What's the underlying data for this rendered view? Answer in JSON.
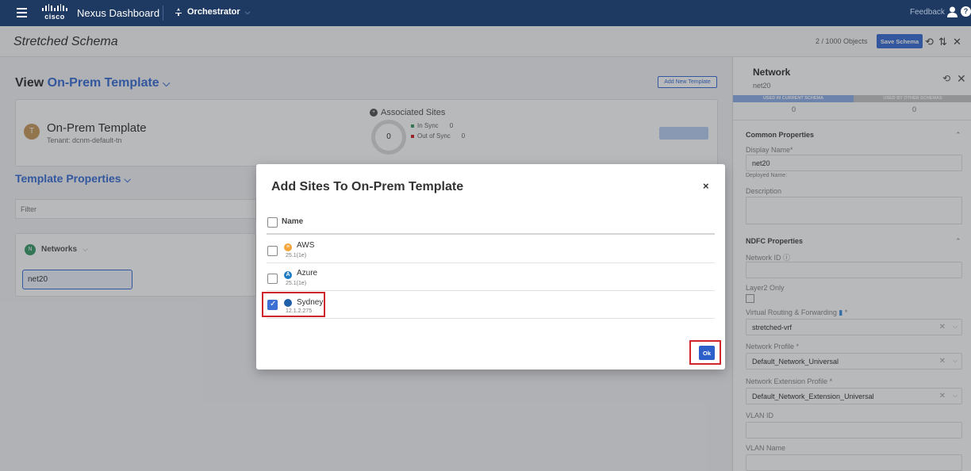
{
  "topnav": {
    "app_title": "Nexus Dashboard",
    "logo_text": "cisco",
    "section": "Orchestrator",
    "feedback": "Feedback",
    "help": "?"
  },
  "schema": {
    "title": "Stretched Schema",
    "object_count": "2 / 1000 Objects",
    "save_label": "Save Schema"
  },
  "view": {
    "prefix": "View",
    "template_name": "On-Prem Template",
    "add_template_label": "Add New Template"
  },
  "template_card": {
    "avatar": "T",
    "name": "On-Prem Template",
    "tenant": "Tenant: dcnm-default-tn",
    "associated_sites_label": "Associated Sites",
    "sites_count": "0",
    "in_sync_label": "In Sync",
    "in_sync_count": "0",
    "out_of_sync_label": "Out of Sync",
    "out_of_sync_count": "0"
  },
  "template_properties": {
    "label": "Template Properties",
    "filter_placeholder": "Filter",
    "networks_icon": "N",
    "networks_label": "Networks",
    "network_item": "net20"
  },
  "right_panel": {
    "title": "Network",
    "subtitle": "net20",
    "tab_current": "USED IN CURRENT SCHEMA",
    "tab_other": "USED BY OTHER SCHEMAS",
    "count_current": "0",
    "count_other": "0",
    "common_section": "Common Properties",
    "display_name_label": "Display Name*",
    "display_name_value": "net20",
    "deployed_name_label": "Deployed Name:",
    "description_label": "Description",
    "ndfc_section": "NDFC Properties",
    "network_id_label": "Network ID",
    "layer2_label": "Layer2 Only",
    "vrf_label": "Virtual Routing & Forwarding",
    "vrf_value": "stretched-vrf",
    "profile_label": "Network Profile",
    "profile_value": "Default_Network_Universal",
    "ext_profile_label": "Network Extension Profile",
    "ext_profile_value": "Default_Network_Extension_Universal",
    "vlan_id_label": "VLAN ID",
    "vlan_name_label": "VLAN Name",
    "required_mark": "*"
  },
  "modal": {
    "title": "Add Sites To On-Prem Template",
    "column_name": "Name",
    "ok_label": "Ok",
    "sites": [
      {
        "name": "AWS",
        "version": "25.1(1e)",
        "checked": false,
        "color": "#f3a53a",
        "icon": "aws-icon"
      },
      {
        "name": "Azure",
        "version": "25.1(1e)",
        "checked": false,
        "color": "#1f7bc2",
        "icon": "azure-icon"
      },
      {
        "name": "Sydney",
        "version": "12.1.2.275",
        "checked": true,
        "color": "#1f5fa8",
        "icon": "ndfc-site-icon"
      }
    ]
  },
  "colors": {
    "navbar": "#1e3a63",
    "accent": "#3b6fd4",
    "highlight_border": "#d0252b"
  }
}
